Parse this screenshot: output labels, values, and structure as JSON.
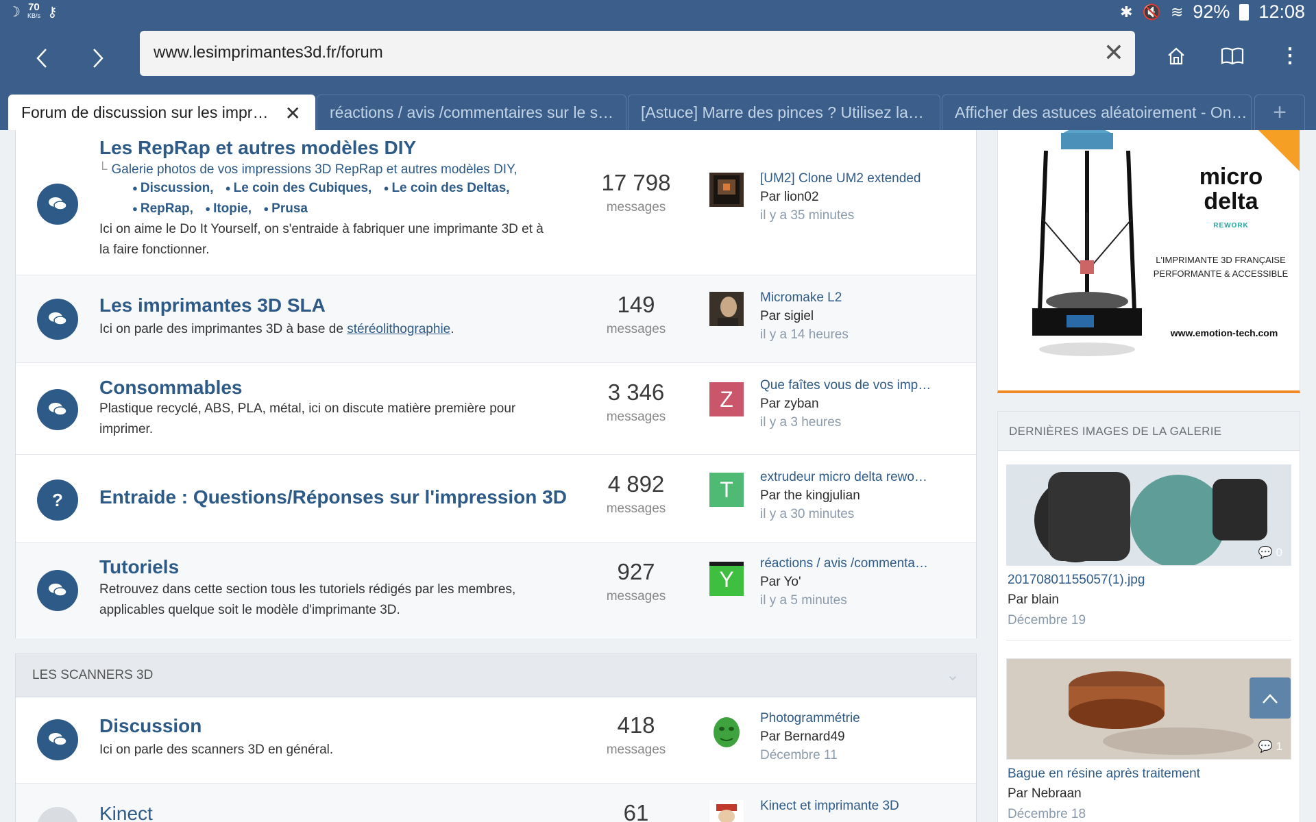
{
  "status_bar": {
    "net_speed": "70",
    "net_speed_unit": "KB/s",
    "battery": "92%",
    "time": "12:08"
  },
  "browser": {
    "url": "www.lesimprimantes3d.fr/forum",
    "tabs": [
      {
        "label": "Forum de discussion sur les impr…",
        "active": true
      },
      {
        "label": "réactions / avis /commentaires sur le s…",
        "active": false
      },
      {
        "label": "[Astuce] Marre des pinces ? Utilisez la…",
        "active": false
      },
      {
        "label": "Afficher des astuces aléatoirement - On…",
        "active": false
      }
    ]
  },
  "forums": [
    {
      "icon": "chat-icon",
      "title": "Les RepRap et autres modèles DIY",
      "sub_link": "Galerie photos de vos impressions 3D RepRap et autres modèles DIY,",
      "subforums": [
        "Discussion,",
        "Le coin des Cubiques,",
        "Le coin des Deltas,",
        "RepRap,",
        "Itopie,",
        "Prusa"
      ],
      "desc": "Ici on aime le Do It Yourself, on s'entraide à fabriquer une imprimante 3D et à la faire fonctionner.",
      "count": "17 798",
      "count_label": "messages",
      "last_title": "[UM2] Clone UM2 extended",
      "last_by": "Par lion02",
      "last_time": "il y a 35 minutes"
    },
    {
      "icon": "chat-icon",
      "title": "Les imprimantes 3D SLA",
      "desc_prefix": "Ici on parle des imprimantes 3D à base de ",
      "desc_link": "stéréolithographie",
      "desc_suffix": ".",
      "count": "149",
      "count_label": "messages",
      "last_title": "Micromake L2",
      "last_by": "Par sigiel",
      "last_time": "il y a 14 heures"
    },
    {
      "icon": "chat-icon",
      "title": "Consommables",
      "desc": "Plastique recyclé, ABS, PLA, métal, ici on discute matière première pour imprimer.",
      "count": "3 346",
      "count_label": "messages",
      "avatar_letter": "Z",
      "avatar_color": "#c9566b",
      "last_title": "Que faîtes vous de vos imp…",
      "last_by": "Par zyban",
      "last_time": "il y a 3 heures"
    },
    {
      "icon": "question-icon",
      "icon_text": "?",
      "title": "Entraide : Questions/Réponses sur l'impression 3D",
      "count": "4 892",
      "count_label": "messages",
      "avatar_letter": "T",
      "avatar_color": "#4fba74",
      "last_title": "extrudeur micro delta rewo…",
      "last_by": "Par the kingjulian",
      "last_time": "il y a 30 minutes"
    },
    {
      "icon": "chat-icon",
      "title": "Tutoriels",
      "desc": "Retrouvez dans cette section tous les tutoriels rédigés par les membres, applicables quelque soit le modèle d'imprimante 3D.",
      "count": "927",
      "count_label": "messages",
      "avatar_letter": "Y",
      "avatar_color": "#3fbf3f",
      "last_title": "réactions / avis /commenta…",
      "last_by": "Par Yo'",
      "last_time": "il y a 5 minutes"
    }
  ],
  "scanners_category": {
    "title": "LES SCANNERS 3D",
    "forums": [
      {
        "title": "Discussion",
        "desc": "Ici on parle des scanners 3D en général.",
        "count": "418",
        "count_label": "messages",
        "last_title": "Photogrammétrie",
        "last_by": "Par Bernard49",
        "last_time": "Décembre 11"
      },
      {
        "title": "Kinect",
        "count": "61",
        "last_title": "Kinect et imprimante 3D"
      }
    ]
  },
  "ad": {
    "brand_line1": "micro",
    "brand_line2": "delta",
    "brand_sub": "REWORK",
    "tagline": "L'IMPRIMANTE 3D FRANÇAISE PERFORMANTE & ACCESSIBLE",
    "url": "www.emotion-tech.com"
  },
  "gallery": {
    "title": "DERNIÈRES IMAGES DE LA GALERIE",
    "items": [
      {
        "name": "20170801155057(1).jpg",
        "by": "Par blain",
        "date": "Décembre 19",
        "comments": "0"
      },
      {
        "name": "Bague en résine après traitement",
        "by": "Par Nebraan",
        "date": "Décembre 18",
        "comments": "1"
      }
    ]
  },
  "colors": {
    "brand_blue": "#3b5f8a",
    "link_blue": "#2d5a86",
    "annotation_red": "#d61a1a",
    "ad_orange": "#f08a24"
  }
}
